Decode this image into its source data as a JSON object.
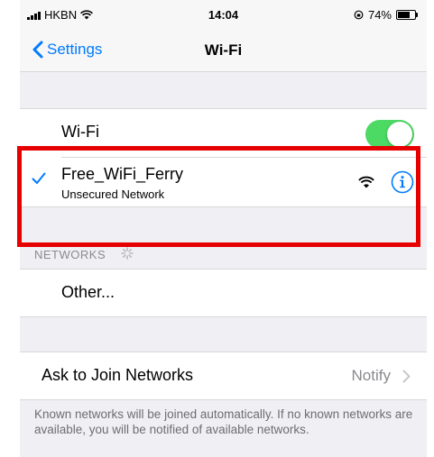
{
  "status_bar": {
    "carrier": "HKBN",
    "time": "14:04",
    "battery_percent": "74%",
    "battery_level": 0.74
  },
  "nav": {
    "back_label": "Settings",
    "title": "Wi-Fi"
  },
  "wifi_toggle": {
    "label": "Wi-Fi",
    "enabled": true
  },
  "connected_network": {
    "name": "Free_WiFi_Ferry",
    "subtitle": "Unsecured Network",
    "icons": [
      "checkmark-icon",
      "wifi-signal-icon",
      "info-icon"
    ]
  },
  "networks_section": {
    "header": "NETWORKS",
    "other_label": "Other..."
  },
  "ask_to_join": {
    "label": "Ask to Join Networks",
    "value": "Notify"
  },
  "footer_text": "Known networks will be joined automatically. If no known networks are available, you will be notified of available networks.",
  "colors": {
    "accent": "#007aff",
    "toggle_on": "#4cd964",
    "highlight": "#e60000",
    "background": "#efeff4"
  }
}
